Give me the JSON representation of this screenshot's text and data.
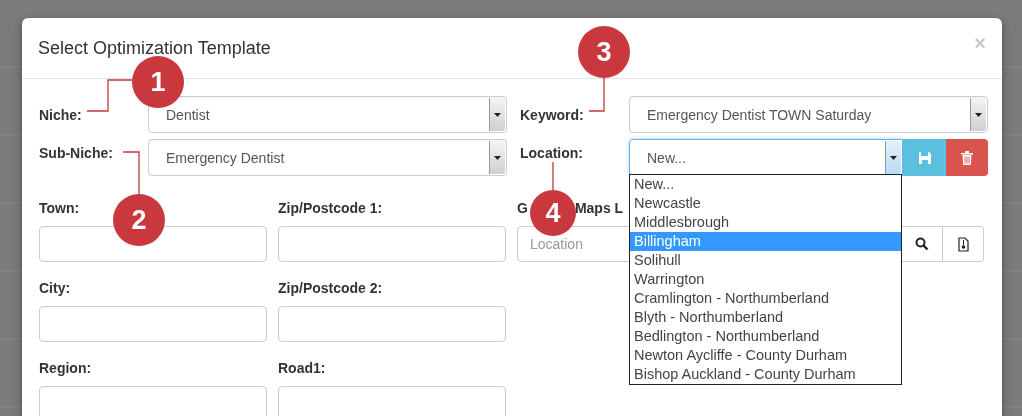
{
  "dialog": {
    "title": "Select Optimization Template",
    "close": "×"
  },
  "left_selects": [
    {
      "label": "Niche:",
      "value": "Dentist"
    },
    {
      "label": "Sub-Niche:",
      "value": "Emergency Dentist"
    }
  ],
  "keyword": {
    "label": "Keyword:",
    "value": "Emergency Dentist TOWN Saturday"
  },
  "location": {
    "label": "Location:",
    "value": "New...",
    "expanded": true
  },
  "fields": [
    {
      "label": "Town:"
    },
    {
      "label": "Zip/Postcode 1:"
    },
    {
      "label": "City:"
    },
    {
      "label": "Zip/Postcode 2:"
    },
    {
      "label": "Region:"
    },
    {
      "label": "Road1:"
    }
  ],
  "maps": {
    "label_parts": [
      "G",
      "Maps L"
    ],
    "placeholder": "Location"
  },
  "location_options": [
    {
      "label": "New...",
      "selected": false
    },
    {
      "label": "Newcastle",
      "selected": false
    },
    {
      "label": "Middlesbrough",
      "selected": false
    },
    {
      "label": "Billingham",
      "selected": true
    },
    {
      "label": "Solihull",
      "selected": false
    },
    {
      "label": "Warrington",
      "selected": false
    },
    {
      "label": "Cramlington - Northumberland",
      "selected": false
    },
    {
      "label": "Blyth - Northumberland",
      "selected": false
    },
    {
      "label": "Bedlington - Northumberland",
      "selected": false
    },
    {
      "label": "Newton Aycliffe - County Durham",
      "selected": false
    },
    {
      "label": "Bishop Auckland - County Durham",
      "selected": false
    }
  ],
  "callouts": [
    "1",
    "2",
    "3",
    "4"
  ]
}
